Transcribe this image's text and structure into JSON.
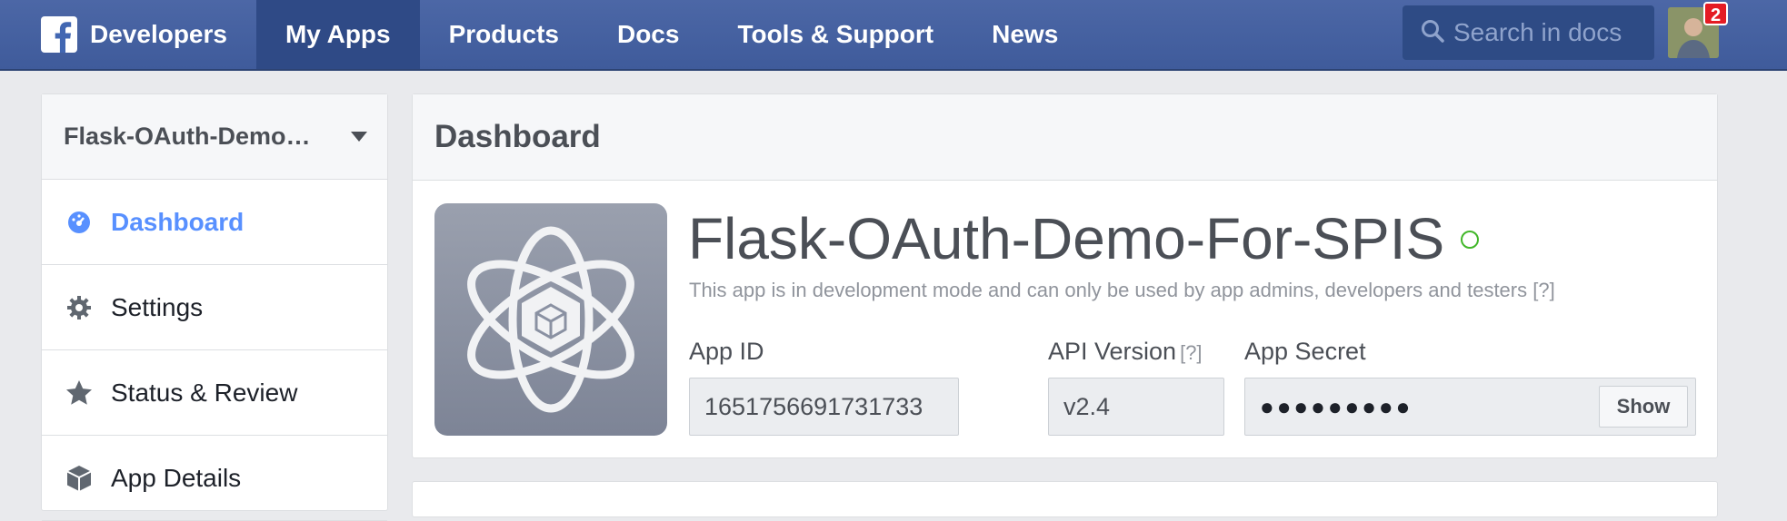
{
  "topnav": {
    "brand": "Developers",
    "items": [
      {
        "label": "My Apps",
        "active": true
      },
      {
        "label": "Products"
      },
      {
        "label": "Docs"
      },
      {
        "label": "Tools & Support"
      },
      {
        "label": "News"
      }
    ],
    "search_placeholder": "Search in docs",
    "notification_count": "2",
    "bar_color": "#4267b2"
  },
  "sidebar": {
    "app_selector": "Flask-OAuth-Demo…",
    "items": [
      {
        "label": "Dashboard",
        "icon": "dashboard-icon",
        "active": true
      },
      {
        "label": "Settings",
        "icon": "gear-icon"
      },
      {
        "label": "Status & Review",
        "icon": "star-icon"
      },
      {
        "label": "App Details",
        "icon": "cube-icon"
      }
    ],
    "active_color": "#5890ff"
  },
  "main": {
    "title": "Dashboard",
    "app_name": "Flask-OAuth-Demo-For-SPIS",
    "dev_note": "This app is in development mode and can only be used by app admins, developers and testers [?]",
    "fields": {
      "app_id": {
        "label": "App ID",
        "value": "1651756691731733"
      },
      "api_version": {
        "label": "API Version",
        "help": "[?]",
        "value": "v2.4"
      },
      "app_secret": {
        "label": "App Secret",
        "value": "●●●●●●●●●",
        "button": "Show"
      }
    },
    "status_color": "#42b72a"
  }
}
